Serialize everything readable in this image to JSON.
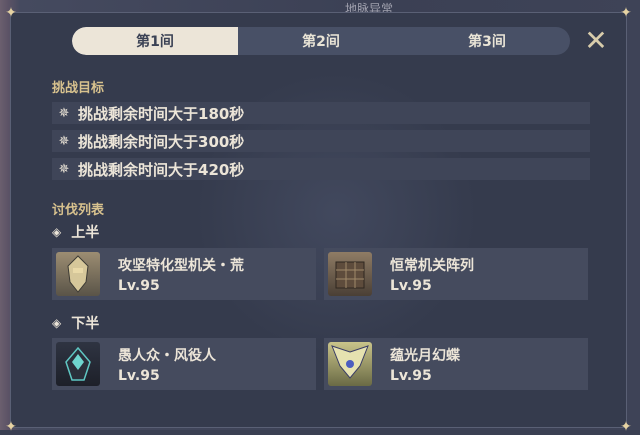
{
  "background": {
    "top_text": "地脉异常"
  },
  "tabs": [
    {
      "label": "第1间",
      "active": true
    },
    {
      "label": "第2间",
      "active": false
    },
    {
      "label": "第3间",
      "active": false
    }
  ],
  "goals": {
    "title": "挑战目标",
    "items": [
      "挑战剩余时间大于180秒",
      "挑战剩余时间大于300秒",
      "挑战剩余时间大于420秒"
    ]
  },
  "enemies": {
    "title": "讨伐列表",
    "first_half": {
      "label": "上半",
      "items": [
        {
          "name": "攻坚特化型机关・荒",
          "level": "Lv.95",
          "icon": "ruin-machine-portrait"
        },
        {
          "name": "恒常机关阵列",
          "level": "Lv.95",
          "icon": "perpetual-mechanical-array-portrait"
        }
      ]
    },
    "second_half": {
      "label": "下半",
      "items": [
        {
          "name": "愚人众・风役人",
          "level": "Lv.95",
          "icon": "fatui-agent-portrait"
        },
        {
          "name": "蕴光月幻蝶",
          "level": "Lv.95",
          "icon": "moonlight-butterfly-portrait"
        }
      ]
    }
  },
  "colors": {
    "accent": "#d8c28e",
    "panel": "#353b4d",
    "tab_active": "#ece5d8"
  }
}
